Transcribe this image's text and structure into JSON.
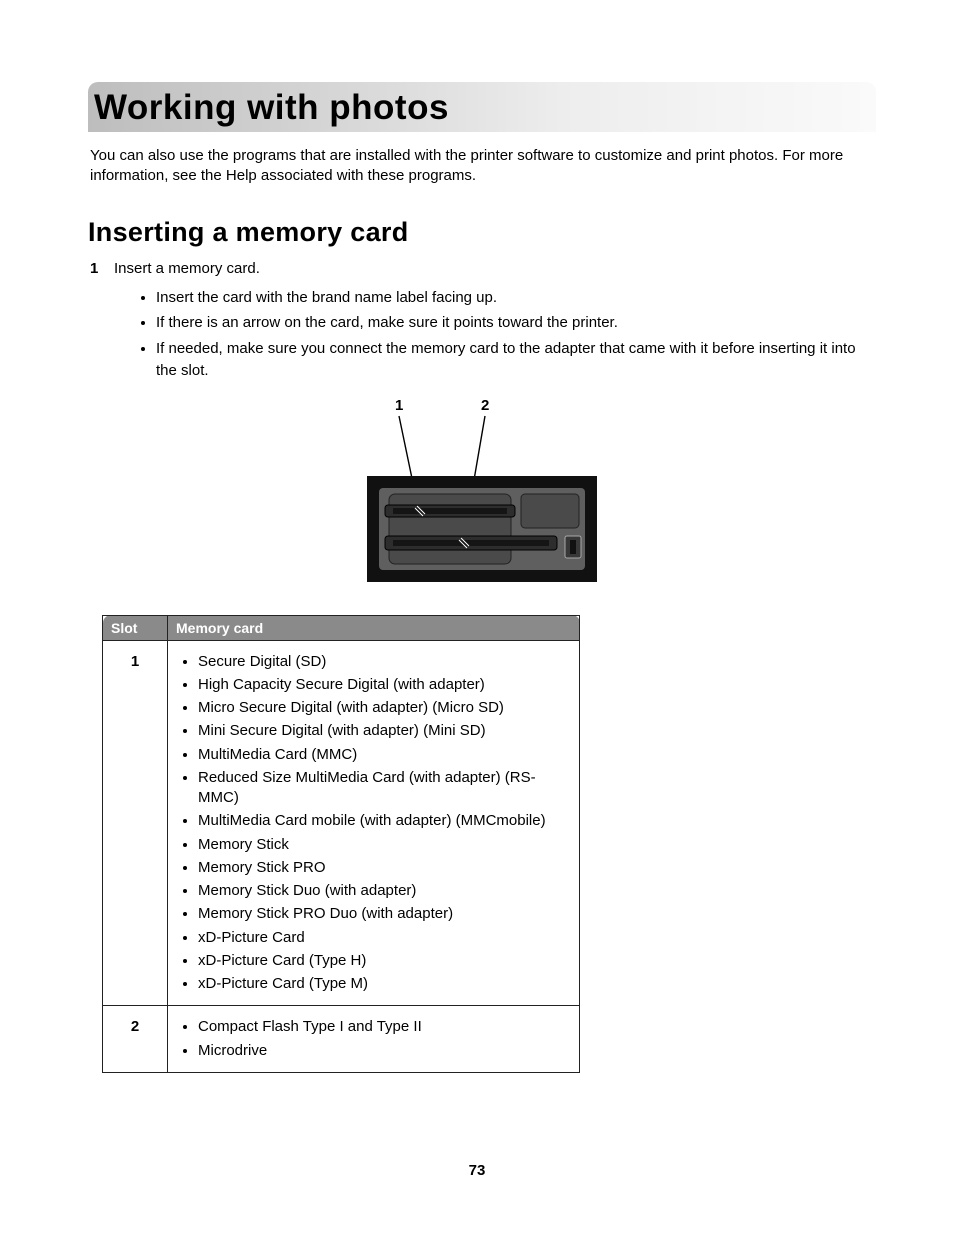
{
  "title": "Working with photos",
  "intro": "You can also use the programs that are installed with the printer software to customize and print photos. For more information, see the Help associated with these programs.",
  "section_heading": "Inserting a memory card",
  "step_number": "1",
  "step_text": "Insert a memory card.",
  "step_bullets": [
    "Insert the card with the brand name label facing up.",
    "If there is an arrow on the card, make sure it points toward the printer.",
    "If needed, make sure you connect the memory card to the adapter that came with it before inserting it into the slot."
  ],
  "diagram_labels": {
    "left": "1",
    "right": "2"
  },
  "table": {
    "headers": [
      "Slot",
      "Memory card"
    ],
    "rows": [
      {
        "slot": "1",
        "cards": [
          "Secure Digital (SD)",
          "High Capacity Secure Digital (with adapter)",
          "Micro Secure Digital (with adapter) (Micro SD)",
          "Mini Secure Digital (with adapter) (Mini SD)",
          "MultiMedia Card (MMC)",
          "Reduced Size MultiMedia Card (with adapter) (RS-MMC)",
          "MultiMedia Card mobile (with adapter) (MMCmobile)",
          "Memory Stick",
          "Memory Stick PRO",
          "Memory Stick Duo (with adapter)",
          "Memory Stick PRO Duo (with adapter)",
          "xD-Picture Card",
          "xD-Picture Card (Type H)",
          "xD-Picture Card (Type M)"
        ]
      },
      {
        "slot": "2",
        "cards": [
          "Compact Flash Type I and Type II",
          "Microdrive"
        ]
      }
    ]
  },
  "page_number": "73"
}
